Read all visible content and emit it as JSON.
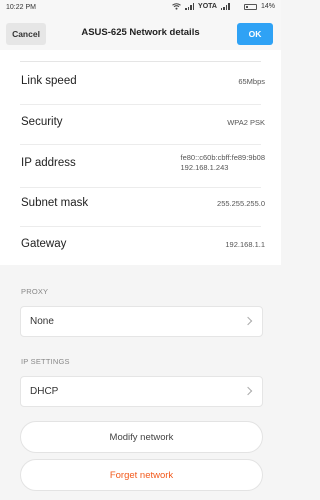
{
  "status_bar": {
    "time": "10:22 PM",
    "carrier": "YOTA",
    "battery": "14%",
    "icons": [
      "wifi-icon",
      "signal-icon",
      "signal-icon",
      "battery-icon"
    ]
  },
  "header": {
    "cancel_label": "Cancel",
    "title": "ASUS-625 Network details",
    "ok_label": "OK",
    "accent_color": "#2fa2f5"
  },
  "details": [
    {
      "label": "Link speed",
      "value": "65Mbps"
    },
    {
      "label": "Security",
      "value": "WPA2 PSK"
    },
    {
      "label": "IP address",
      "value": "fe80::c60b:cbff:fe89:9b08\n192.168.1.243"
    },
    {
      "label": "Subnet mask",
      "value": "255.255.255.0"
    },
    {
      "label": "Gateway",
      "value": "192.168.1.1"
    }
  ],
  "proxy": {
    "section_label": "PROXY",
    "value": "None"
  },
  "ip_settings": {
    "section_label": "IP SETTINGS",
    "value": "DHCP"
  },
  "actions": {
    "modify_label": "Modify network",
    "forget_label": "Forget network",
    "forget_color": "#f25a1c"
  }
}
